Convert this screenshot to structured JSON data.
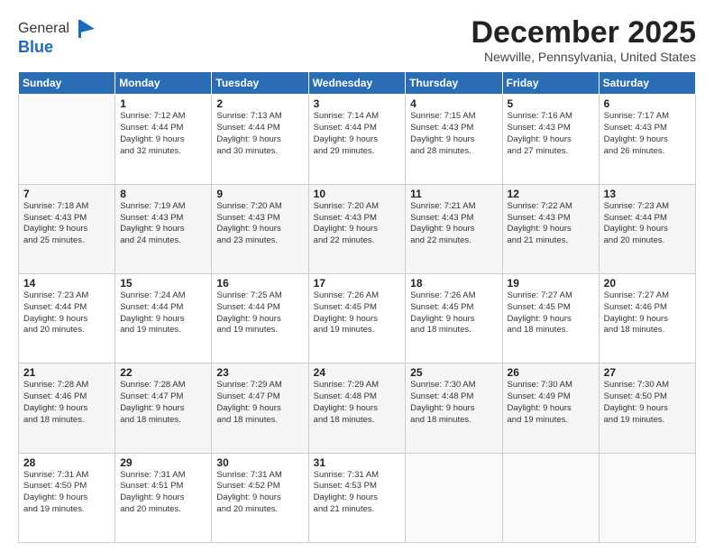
{
  "logo": {
    "general": "General",
    "blue": "Blue"
  },
  "header": {
    "month": "December 2025",
    "location": "Newville, Pennsylvania, United States"
  },
  "weekdays": [
    "Sunday",
    "Monday",
    "Tuesday",
    "Wednesday",
    "Thursday",
    "Friday",
    "Saturday"
  ],
  "weeks": [
    [
      {
        "day": "",
        "info": ""
      },
      {
        "day": "1",
        "info": "Sunrise: 7:12 AM\nSunset: 4:44 PM\nDaylight: 9 hours\nand 32 minutes."
      },
      {
        "day": "2",
        "info": "Sunrise: 7:13 AM\nSunset: 4:44 PM\nDaylight: 9 hours\nand 30 minutes."
      },
      {
        "day": "3",
        "info": "Sunrise: 7:14 AM\nSunset: 4:44 PM\nDaylight: 9 hours\nand 29 minutes."
      },
      {
        "day": "4",
        "info": "Sunrise: 7:15 AM\nSunset: 4:43 PM\nDaylight: 9 hours\nand 28 minutes."
      },
      {
        "day": "5",
        "info": "Sunrise: 7:16 AM\nSunset: 4:43 PM\nDaylight: 9 hours\nand 27 minutes."
      },
      {
        "day": "6",
        "info": "Sunrise: 7:17 AM\nSunset: 4:43 PM\nDaylight: 9 hours\nand 26 minutes."
      }
    ],
    [
      {
        "day": "7",
        "info": "Sunrise: 7:18 AM\nSunset: 4:43 PM\nDaylight: 9 hours\nand 25 minutes."
      },
      {
        "day": "8",
        "info": "Sunrise: 7:19 AM\nSunset: 4:43 PM\nDaylight: 9 hours\nand 24 minutes."
      },
      {
        "day": "9",
        "info": "Sunrise: 7:20 AM\nSunset: 4:43 PM\nDaylight: 9 hours\nand 23 minutes."
      },
      {
        "day": "10",
        "info": "Sunrise: 7:20 AM\nSunset: 4:43 PM\nDaylight: 9 hours\nand 22 minutes."
      },
      {
        "day": "11",
        "info": "Sunrise: 7:21 AM\nSunset: 4:43 PM\nDaylight: 9 hours\nand 22 minutes."
      },
      {
        "day": "12",
        "info": "Sunrise: 7:22 AM\nSunset: 4:43 PM\nDaylight: 9 hours\nand 21 minutes."
      },
      {
        "day": "13",
        "info": "Sunrise: 7:23 AM\nSunset: 4:44 PM\nDaylight: 9 hours\nand 20 minutes."
      }
    ],
    [
      {
        "day": "14",
        "info": "Sunrise: 7:23 AM\nSunset: 4:44 PM\nDaylight: 9 hours\nand 20 minutes."
      },
      {
        "day": "15",
        "info": "Sunrise: 7:24 AM\nSunset: 4:44 PM\nDaylight: 9 hours\nand 19 minutes."
      },
      {
        "day": "16",
        "info": "Sunrise: 7:25 AM\nSunset: 4:44 PM\nDaylight: 9 hours\nand 19 minutes."
      },
      {
        "day": "17",
        "info": "Sunrise: 7:26 AM\nSunset: 4:45 PM\nDaylight: 9 hours\nand 19 minutes."
      },
      {
        "day": "18",
        "info": "Sunrise: 7:26 AM\nSunset: 4:45 PM\nDaylight: 9 hours\nand 18 minutes."
      },
      {
        "day": "19",
        "info": "Sunrise: 7:27 AM\nSunset: 4:45 PM\nDaylight: 9 hours\nand 18 minutes."
      },
      {
        "day": "20",
        "info": "Sunrise: 7:27 AM\nSunset: 4:46 PM\nDaylight: 9 hours\nand 18 minutes."
      }
    ],
    [
      {
        "day": "21",
        "info": "Sunrise: 7:28 AM\nSunset: 4:46 PM\nDaylight: 9 hours\nand 18 minutes."
      },
      {
        "day": "22",
        "info": "Sunrise: 7:28 AM\nSunset: 4:47 PM\nDaylight: 9 hours\nand 18 minutes."
      },
      {
        "day": "23",
        "info": "Sunrise: 7:29 AM\nSunset: 4:47 PM\nDaylight: 9 hours\nand 18 minutes."
      },
      {
        "day": "24",
        "info": "Sunrise: 7:29 AM\nSunset: 4:48 PM\nDaylight: 9 hours\nand 18 minutes."
      },
      {
        "day": "25",
        "info": "Sunrise: 7:30 AM\nSunset: 4:48 PM\nDaylight: 9 hours\nand 18 minutes."
      },
      {
        "day": "26",
        "info": "Sunrise: 7:30 AM\nSunset: 4:49 PM\nDaylight: 9 hours\nand 19 minutes."
      },
      {
        "day": "27",
        "info": "Sunrise: 7:30 AM\nSunset: 4:50 PM\nDaylight: 9 hours\nand 19 minutes."
      }
    ],
    [
      {
        "day": "28",
        "info": "Sunrise: 7:31 AM\nSunset: 4:50 PM\nDaylight: 9 hours\nand 19 minutes."
      },
      {
        "day": "29",
        "info": "Sunrise: 7:31 AM\nSunset: 4:51 PM\nDaylight: 9 hours\nand 20 minutes."
      },
      {
        "day": "30",
        "info": "Sunrise: 7:31 AM\nSunset: 4:52 PM\nDaylight: 9 hours\nand 20 minutes."
      },
      {
        "day": "31",
        "info": "Sunrise: 7:31 AM\nSunset: 4:53 PM\nDaylight: 9 hours\nand 21 minutes."
      },
      {
        "day": "",
        "info": ""
      },
      {
        "day": "",
        "info": ""
      },
      {
        "day": "",
        "info": ""
      }
    ]
  ]
}
